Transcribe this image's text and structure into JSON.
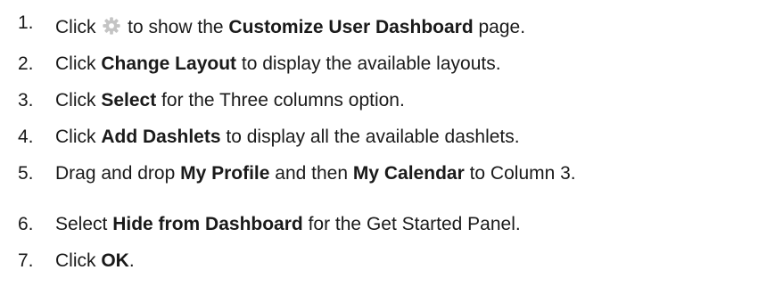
{
  "icons": {
    "settings": "gear-icon",
    "gear_color": "#c4c4c4"
  },
  "steps": [
    {
      "number": "1.",
      "pre": "Click ",
      "post": " to show the ",
      "bold": "Customize User Dashboard",
      "end": " page."
    },
    {
      "number": "2.",
      "pre": "Click ",
      "bold": "Change Layout",
      "end": " to display the available layouts."
    },
    {
      "number": "3.",
      "pre": "Click ",
      "bold": "Select",
      "end": " for the Three columns option."
    },
    {
      "number": "4.",
      "pre": "Click ",
      "bold": "Add Dashlets",
      "end": " to display all the available dashlets."
    },
    {
      "number": "5.",
      "pre": "Drag and drop ",
      "bold": "My Profile",
      "mid": " and then ",
      "bold2": "My Calendar",
      "end": " to Column 3."
    },
    {
      "number": "6.",
      "pre": "Select ",
      "bold": "Hide from Dashboard",
      "end": " for the Get Started Panel."
    },
    {
      "number": "7.",
      "pre": "Click ",
      "bold": "OK",
      "end": "."
    }
  ]
}
